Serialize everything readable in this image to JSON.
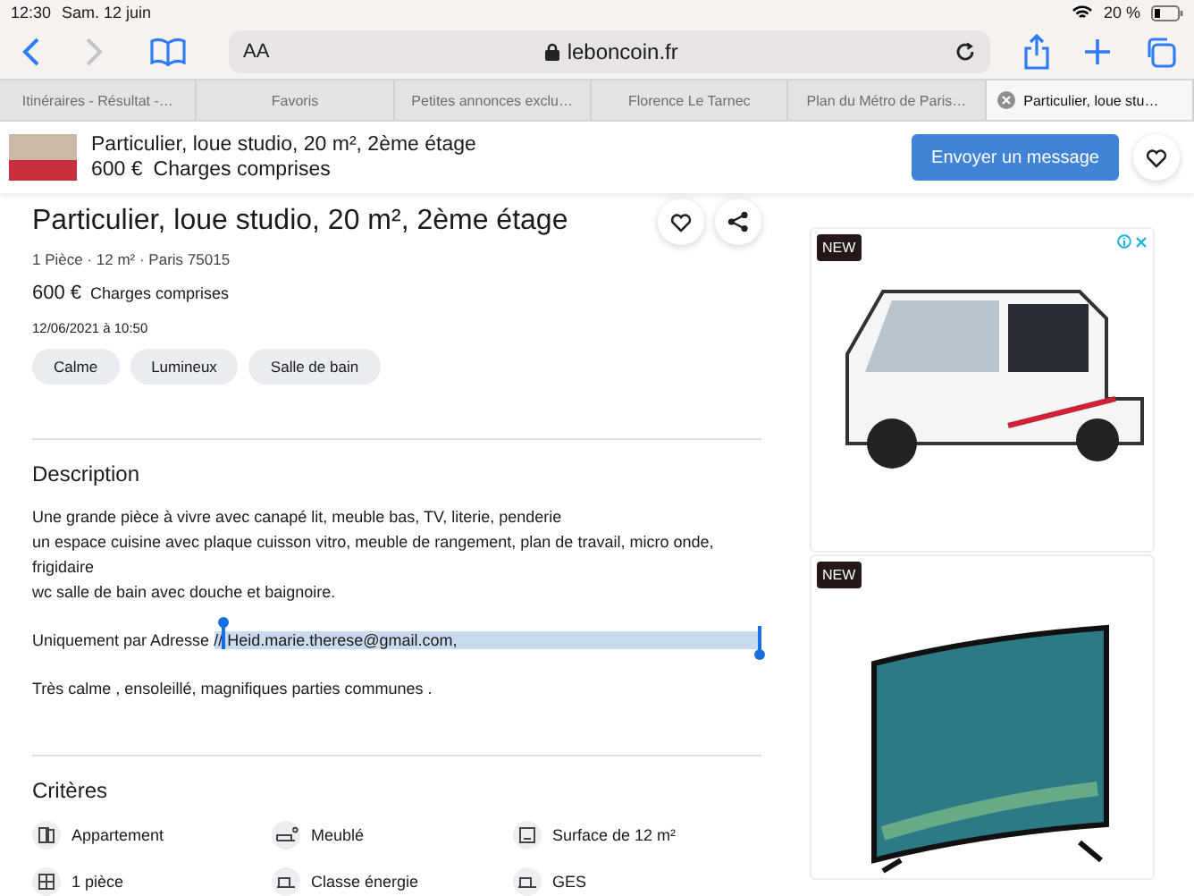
{
  "status_bar": {
    "time": "12:30",
    "date": "Sam. 12 juin",
    "battery": "20 %"
  },
  "toolbar": {
    "text_size": "AA",
    "address": "leboncoin.fr"
  },
  "tabs": [
    {
      "label": "Itinéraires - Résultat -…",
      "selected": false
    },
    {
      "label": "Favoris",
      "selected": false
    },
    {
      "label": "Petites annonces exclu…",
      "selected": false
    },
    {
      "label": "Florence Le Tarnec",
      "selected": false
    },
    {
      "label": "Plan du Métro de Paris…",
      "selected": false
    },
    {
      "label": "Particulier, loue stu…",
      "selected": true
    }
  ],
  "sticky_header": {
    "title": "Particulier, loue studio, 20 m², 2ème étage",
    "price": "600 €",
    "price_note": "Charges comprises",
    "button": "Envoyer un message"
  },
  "listing": {
    "title": "Particulier, loue studio, 20 m², 2ème étage",
    "summary": "1 Pièce · 12 m² · Paris 75015",
    "price": "600 €",
    "price_note": "Charges comprises",
    "date": "12/06/2021 à 10:50",
    "tags": [
      "Calme",
      "Lumineux",
      "Salle de bain"
    ]
  },
  "description": {
    "heading": "Description",
    "paragraphs": [
      "Une grande pièce à vivre avec canapé lit, meuble bas, TV, literie, penderie\nun espace cuisine avec plaque cuisson vitro, meuble de rangement, plan de travail, micro onde, frigidaire\nwc salle de bain avec douche et baignoire."
    ],
    "selection_line": {
      "before": "Uniquement par Adresse",
      "selected_text": "// Heid.marie.therese@gmail.com,"
    },
    "closing": "Très calme , ensoleillé, magnifiques parties communes ."
  },
  "criteria": {
    "heading": "Critères",
    "items": [
      {
        "kind": "building",
        "label": "Appartement"
      },
      {
        "kind": "bed",
        "label": "Meublé"
      },
      {
        "kind": "square",
        "label": "Surface de 12 m²"
      },
      {
        "kind": "rooms",
        "label": "1 pièce"
      },
      {
        "kind": "energy",
        "label": "Classe énergie"
      },
      {
        "kind": "energy",
        "label": "GES"
      }
    ]
  },
  "ads": [
    {
      "badge": "NEW",
      "kind": "vehicle"
    },
    {
      "badge": "NEW",
      "kind": "tv"
    }
  ]
}
